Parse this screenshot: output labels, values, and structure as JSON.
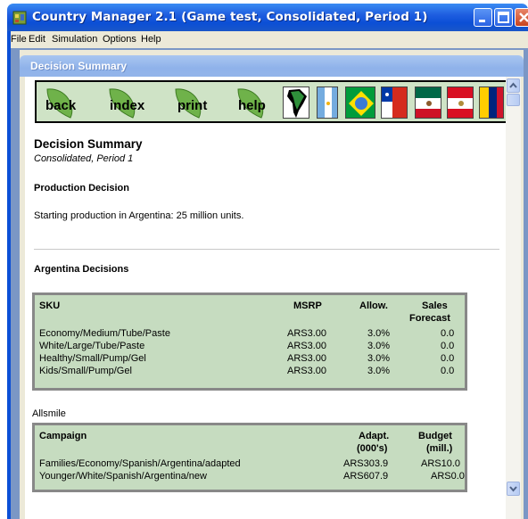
{
  "window": {
    "title": "Country Manager 2.1 (Game test, Consolidated, Period 1)"
  },
  "menu": [
    {
      "label": "File"
    },
    {
      "label": "Edit"
    },
    {
      "label": "Simulation"
    },
    {
      "label": "Options"
    },
    {
      "label": "Help"
    }
  ],
  "child_window": {
    "title": "Decision Summary"
  },
  "nav": {
    "back": "back",
    "index": "index",
    "print": "print",
    "help": "help"
  },
  "page": {
    "title": "Decision Summary",
    "subtitle": "Consolidated, Period 1",
    "production_heading": "Production Decision",
    "production_text": "Starting production in Argentina: 25 million units.",
    "country_heading": "Argentina Decisions"
  },
  "sku_table": {
    "headers": {
      "sku": "SKU",
      "msrp": "MSRP",
      "allow": "Allow.",
      "sales1": "Sales",
      "sales2": "Forecast"
    },
    "rows": [
      {
        "sku": "Economy/Medium/Tube/Paste",
        "msrp": "ARS3.00",
        "allow": "3.0%",
        "forecast": "0.0"
      },
      {
        "sku": "White/Large/Tube/Paste",
        "msrp": "ARS3.00",
        "allow": "3.0%",
        "forecast": "0.0"
      },
      {
        "sku": "Healthy/Small/Pump/Gel",
        "msrp": "ARS3.00",
        "allow": "3.0%",
        "forecast": "0.0"
      },
      {
        "sku": "Kids/Small/Pump/Gel",
        "msrp": "ARS3.00",
        "allow": "3.0%",
        "forecast": "0.0"
      }
    ]
  },
  "brand_label": "Allsmile",
  "campaign_table": {
    "headers": {
      "campaign": "Campaign",
      "adapt1": "Adapt.",
      "adapt2": "(000's)",
      "budget1": "Budget",
      "budget2": "(mill.)"
    },
    "rows": [
      {
        "campaign": "Families/Economy/Spanish/Argentina/adapted",
        "adapt": "ARS303.9",
        "budget": "ARS10.0"
      },
      {
        "campaign": "Younger/White/Spanish/Argentina/new",
        "adapt": "ARS607.9",
        "budget": "ARS0.0"
      }
    ]
  },
  "colors": {
    "titlebar": "#0b4fd6",
    "nav_bg": "#cfe3c6",
    "table_bg": "#c6dcc0"
  }
}
